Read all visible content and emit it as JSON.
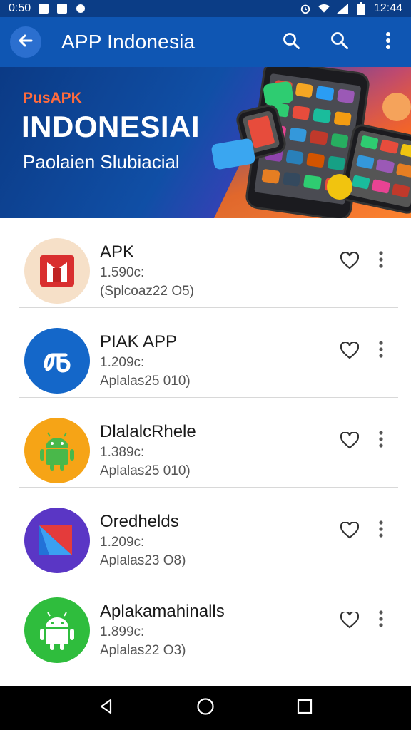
{
  "status_bar": {
    "time_left": "0:50",
    "time_right": "12:44",
    "left_icons": [
      "notification-box-icon",
      "notification-box-icon",
      "notification-dot-icon"
    ],
    "right_icons": [
      "alarm-icon",
      "wifi-icon",
      "signal-icon",
      "battery-icon"
    ]
  },
  "app_bar": {
    "title": "APP Indonesia",
    "back_icon": "arrow-left-icon",
    "actions": [
      "search-icon",
      "search-icon",
      "more-vertical-icon"
    ]
  },
  "banner": {
    "kicker": "PusAPK",
    "title": "INDONESIAI",
    "subtitle": "Paolaien Slubiacial"
  },
  "apps": [
    {
      "name": "APK",
      "size": "1.590c:",
      "date": "(Splcoaz22 O5)",
      "icon": "red-folder-icon",
      "icon_bg": "#f6e0c8"
    },
    {
      "name": "PIAK APP",
      "size": "1.209c:",
      "date": "Aplalas25 010)",
      "icon": "blue-music-icon",
      "icon_bg": "#1467c9"
    },
    {
      "name": "DlalalcRhele",
      "size": "1.389c:",
      "date": "Aplalas25 010)",
      "icon": "android-robot-icon",
      "icon_bg": "#f6a416"
    },
    {
      "name": "Oredhelds",
      "size": "1.209c:",
      "date": "Aplalas23 O8)",
      "icon": "play-triangle-icon",
      "icon_bg": "#5a36c5"
    },
    {
      "name": "Aplakamahinalls",
      "size": "1.899c:",
      "date": "Aplalas22 O3)",
      "icon": "android-robot-icon",
      "icon_bg": "#2fbd3d"
    }
  ],
  "nav_bar": {
    "buttons": [
      "back-triangle-icon",
      "home-circle-icon",
      "recents-square-icon"
    ]
  }
}
